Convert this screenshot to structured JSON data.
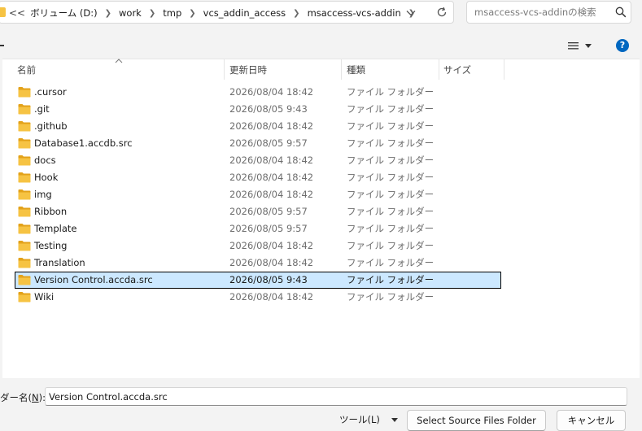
{
  "address_bar": {
    "overflow": "<<",
    "crumbs": [
      "ボリューム (D:)",
      "work",
      "tmp",
      "vcs_addin_access",
      "msaccess-vcs-addin"
    ]
  },
  "search": {
    "placeholder": "msaccess-vcs-addinの検索"
  },
  "toolbar": {
    "help_label": "?"
  },
  "columns": {
    "name": "名前",
    "date": "更新日時",
    "type": "種類",
    "size": "サイズ"
  },
  "files": [
    {
      "name": ".cursor",
      "date": "2026/08/04 18:42",
      "type": "ファイル フォルダー"
    },
    {
      "name": ".git",
      "date": "2026/08/05 9:43",
      "type": "ファイル フォルダー"
    },
    {
      "name": ".github",
      "date": "2026/08/04 18:42",
      "type": "ファイル フォルダー"
    },
    {
      "name": "Database1.accdb.src",
      "date": "2026/08/05 9:57",
      "type": "ファイル フォルダー"
    },
    {
      "name": "docs",
      "date": "2026/08/04 18:42",
      "type": "ファイル フォルダー"
    },
    {
      "name": "Hook",
      "date": "2026/08/04 18:42",
      "type": "ファイル フォルダー"
    },
    {
      "name": "img",
      "date": "2026/08/04 18:42",
      "type": "ファイル フォルダー"
    },
    {
      "name": "Ribbon",
      "date": "2026/08/05 9:57",
      "type": "ファイル フォルダー"
    },
    {
      "name": "Template",
      "date": "2026/08/05 9:57",
      "type": "ファイル フォルダー"
    },
    {
      "name": "Testing",
      "date": "2026/08/04 18:42",
      "type": "ファイル フォルダー"
    },
    {
      "name": "Translation",
      "date": "2026/08/04 18:42",
      "type": "ファイル フォルダー"
    },
    {
      "name": "Version Control.accda.src",
      "date": "2026/08/05 9:43",
      "type": "ファイル フォルダー",
      "selected": true
    },
    {
      "name": "Wiki",
      "date": "2026/08/04 18:42",
      "type": "ファイル フォルダー"
    }
  ],
  "bottom": {
    "folder_label_prefix": "ダー名(",
    "folder_label_key": "N",
    "folder_label_suffix": "):",
    "folder_value": "Version Control.accda.src",
    "tools_label": "ツール(L)",
    "select_button": "Select Source Files Folder",
    "cancel_button": "キャンセル"
  },
  "colors": {
    "folder": "#f6c343",
    "folder_dark": "#e3a21a",
    "selection": "#cce8ff",
    "accent": "#0067c0"
  },
  "icons": {
    "breadcrumb_separator": "chevron-right-icon",
    "address_dropdown": "chevron-down-icon",
    "refresh": "refresh-icon",
    "search": "search-icon",
    "view": "view-list-icon",
    "help": "help-icon",
    "folder": "folder-icon",
    "sort": "sort-up-icon"
  }
}
